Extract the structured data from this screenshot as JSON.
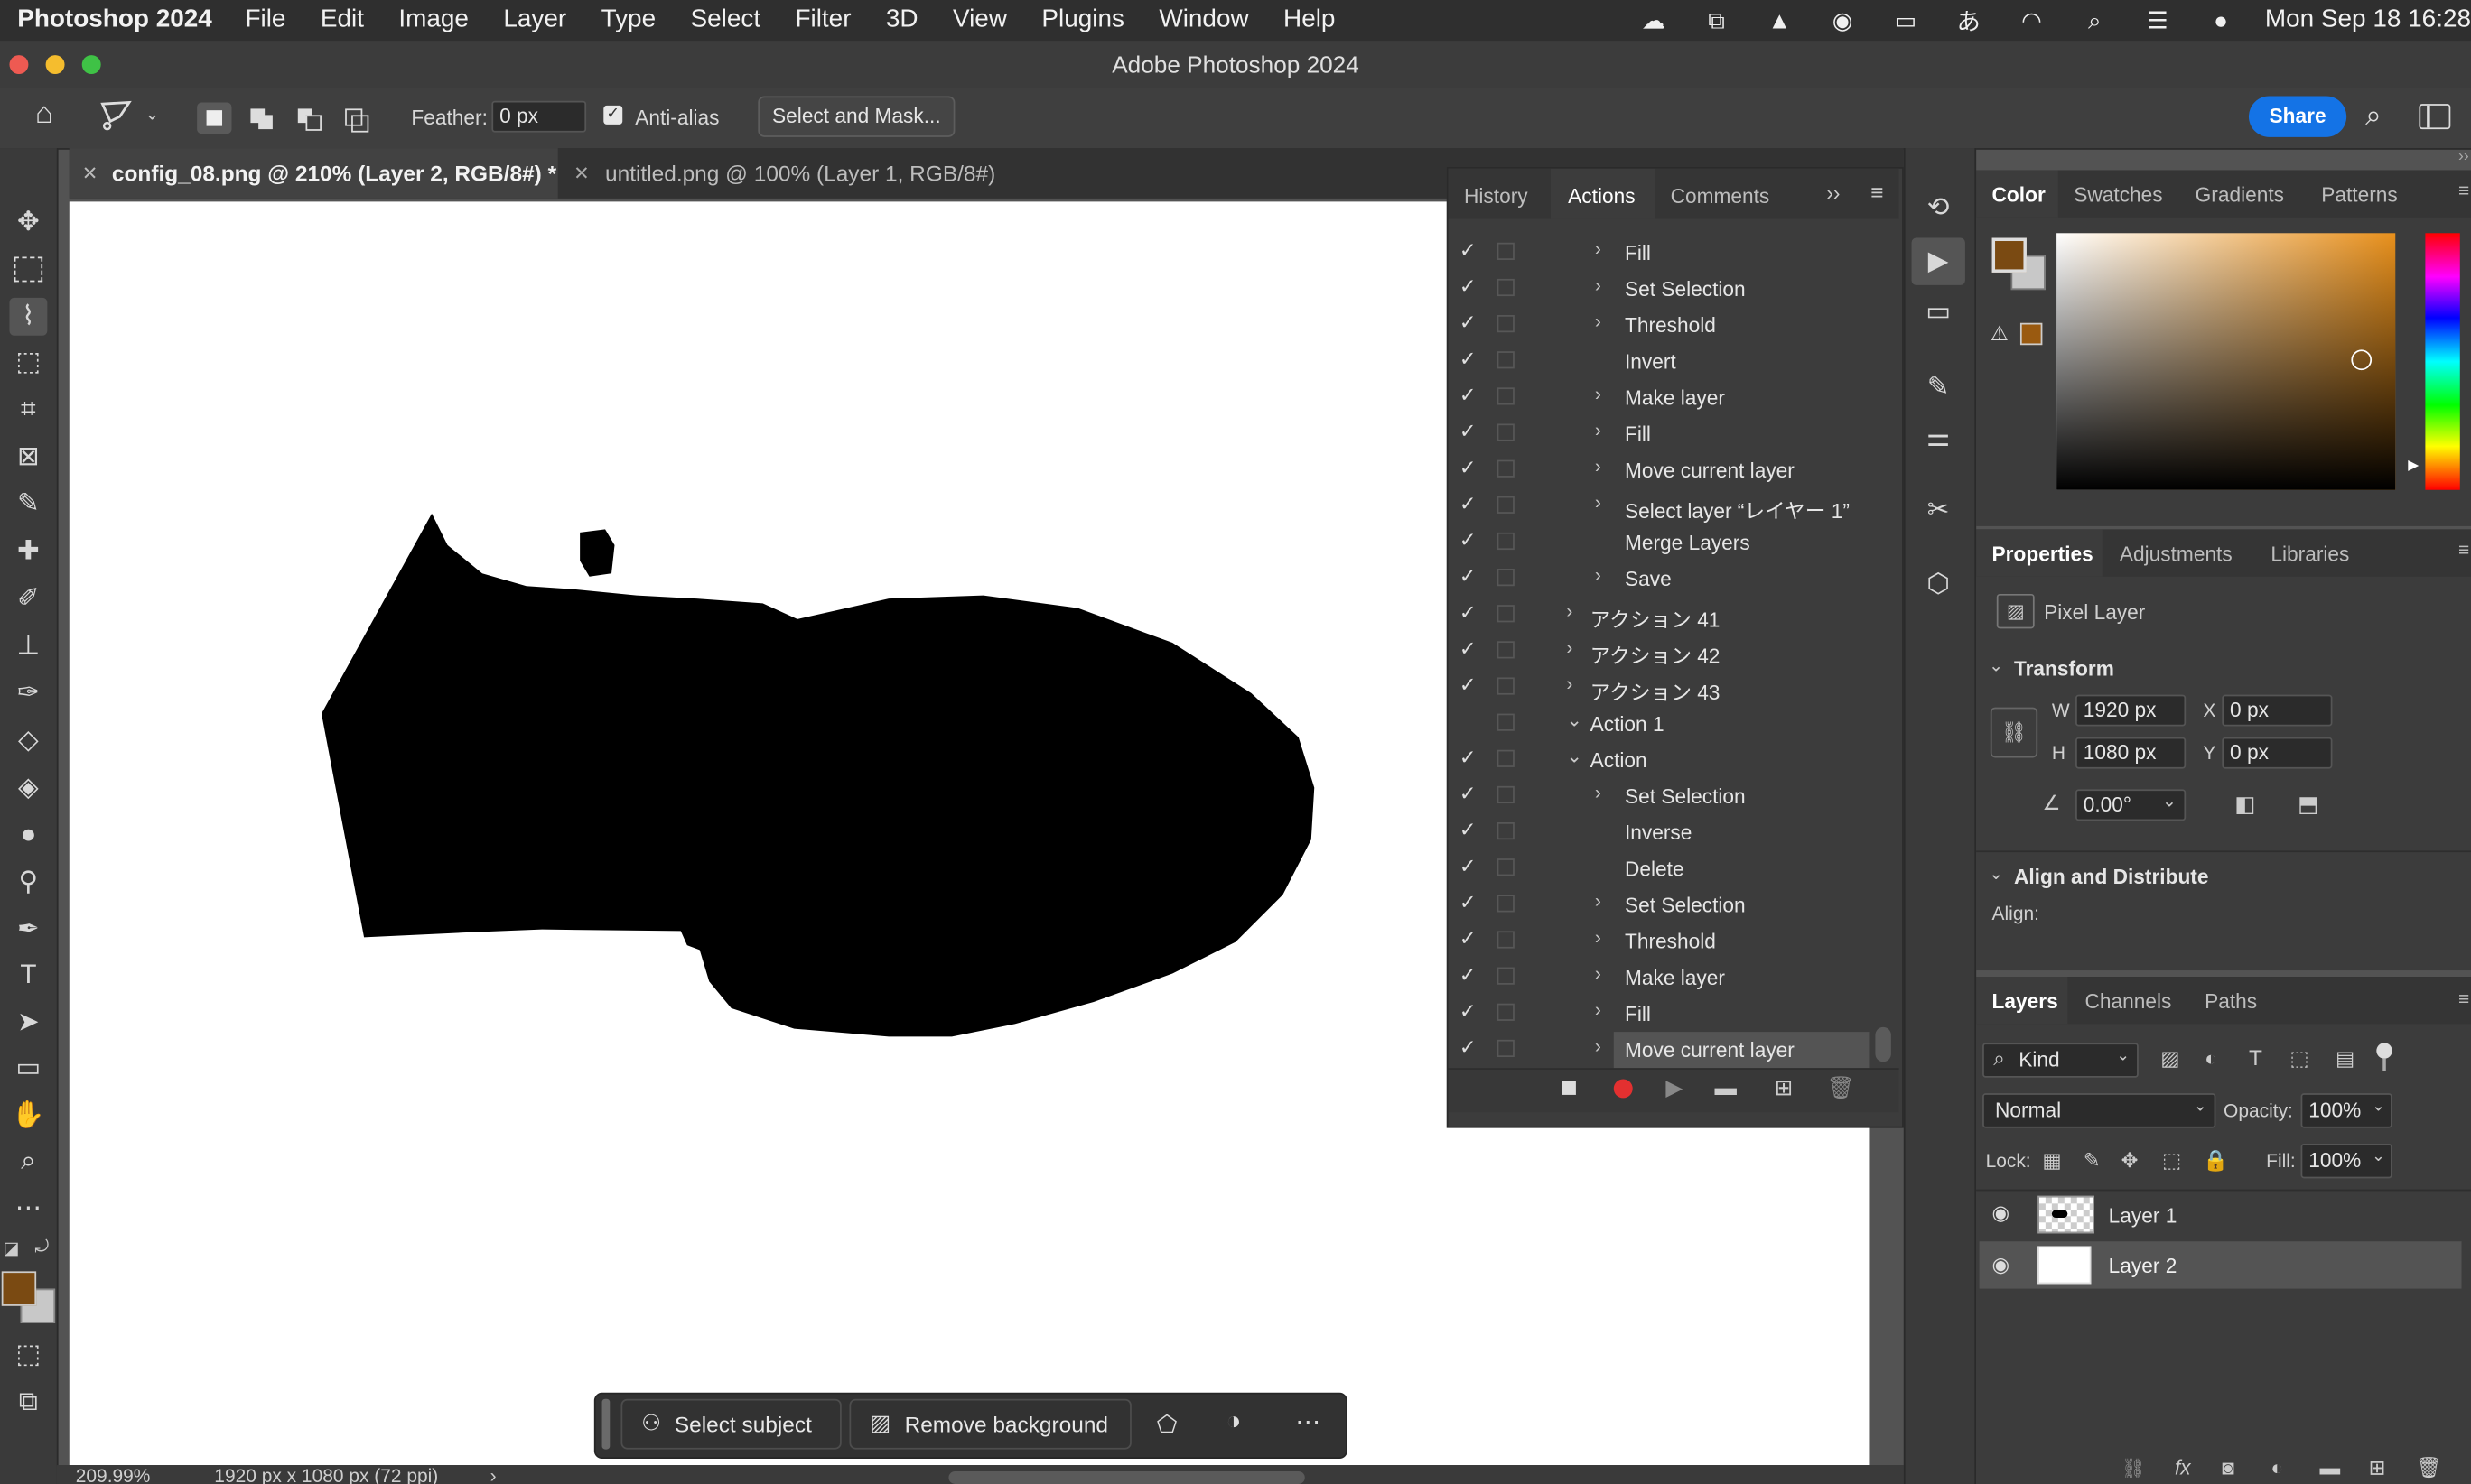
{
  "menubar": {
    "app_name": "Photoshop 2024",
    "items": [
      "File",
      "Edit",
      "Image",
      "Layer",
      "Type",
      "Select",
      "Filter",
      "3D",
      "View",
      "Plugins",
      "Window",
      "Help"
    ],
    "clock": "Mon Sep 18  16:28",
    "status_icons": [
      "creative-cloud-icon",
      "screen-share-icon",
      "acrobat-icon",
      "user-icon",
      "battery-icon",
      "input-method-icon",
      "wifi-icon",
      "spotlight-icon",
      "control-center-icon",
      "siri-icon"
    ],
    "input_method_glyph": "あ"
  },
  "window": {
    "title": "Adobe Photoshop 2024"
  },
  "options": {
    "feather_label": "Feather:",
    "feather_value": "0 px",
    "antialias_label": "Anti-alias",
    "antialias_checked": true,
    "select_mask_label": "Select and Mask...",
    "share_label": "Share"
  },
  "tabs": [
    {
      "label": "config_08.png @ 210% (Layer 2, RGB/8#) *",
      "active": true
    },
    {
      "label": "untitled.png @ 100% (Layer 1, RGB/8#)",
      "active": false
    }
  ],
  "status": {
    "zoom": "209.99%",
    "doc_info": "1920 px x 1080 px (72 ppi)"
  },
  "context_bar": {
    "select_subject": "Select subject",
    "remove_background": "Remove background"
  },
  "actions_panel": {
    "tabs": [
      "History",
      "Actions",
      "Comments"
    ],
    "active_tab": "Actions",
    "rows": [
      {
        "label": "Fill",
        "checked": true,
        "indent": 2,
        "expand": "collapsed"
      },
      {
        "label": "Set Selection",
        "checked": true,
        "indent": 2,
        "expand": "collapsed"
      },
      {
        "label": "Threshold",
        "checked": true,
        "indent": 2,
        "expand": "collapsed"
      },
      {
        "label": "Invert",
        "checked": true,
        "indent": 2,
        "expand": "none"
      },
      {
        "label": "Make layer",
        "checked": true,
        "indent": 2,
        "expand": "collapsed"
      },
      {
        "label": "Fill",
        "checked": true,
        "indent": 2,
        "expand": "collapsed"
      },
      {
        "label": "Move current layer",
        "checked": true,
        "indent": 2,
        "expand": "collapsed"
      },
      {
        "label": "Select layer “レイヤー 1”",
        "checked": true,
        "indent": 2,
        "expand": "collapsed"
      },
      {
        "label": "Merge Layers",
        "checked": true,
        "indent": 2,
        "expand": "none"
      },
      {
        "label": "Save",
        "checked": true,
        "indent": 2,
        "expand": "collapsed"
      },
      {
        "label": "アクション 41",
        "checked": true,
        "indent": 1,
        "expand": "collapsed"
      },
      {
        "label": "アクション 42",
        "checked": true,
        "indent": 1,
        "expand": "collapsed"
      },
      {
        "label": "アクション 43",
        "checked": true,
        "indent": 1,
        "expand": "collapsed"
      },
      {
        "label": "Action 1",
        "checked": false,
        "indent": 1,
        "expand": "expanded"
      },
      {
        "label": "Action",
        "checked": true,
        "indent": 1,
        "expand": "expanded"
      },
      {
        "label": "Set Selection",
        "checked": true,
        "indent": 2,
        "expand": "collapsed"
      },
      {
        "label": "Inverse",
        "checked": true,
        "indent": 2,
        "expand": "none"
      },
      {
        "label": "Delete",
        "checked": true,
        "indent": 2,
        "expand": "none"
      },
      {
        "label": "Set Selection",
        "checked": true,
        "indent": 2,
        "expand": "collapsed"
      },
      {
        "label": "Threshold",
        "checked": true,
        "indent": 2,
        "expand": "collapsed"
      },
      {
        "label": "Make layer",
        "checked": true,
        "indent": 2,
        "expand": "collapsed"
      },
      {
        "label": "Fill",
        "checked": true,
        "indent": 2,
        "expand": "collapsed"
      },
      {
        "label": "Move current layer",
        "checked": true,
        "indent": 2,
        "expand": "collapsed",
        "selected": true
      }
    ]
  },
  "color_panel": {
    "tabs": [
      "Color",
      "Swatches",
      "Gradients",
      "Patterns"
    ],
    "foreground": "#7a4a12",
    "background": "#c8c8c8",
    "hue_base": "#e8901c"
  },
  "properties_panel": {
    "tabs": [
      "Properties",
      "Adjustments",
      "Libraries"
    ],
    "layer_type": "Pixel Layer",
    "transform_label": "Transform",
    "w_label": "W",
    "w_value": "1920 px",
    "h_label": "H",
    "h_value": "1080 px",
    "x_label": "X",
    "x_value": "0 px",
    "y_label": "Y",
    "y_value": "0 px",
    "angle_value": "0.00°",
    "align_label": "Align and Distribute",
    "align_sub": "Align:"
  },
  "layers_panel": {
    "tabs": [
      "Layers",
      "Channels",
      "Paths"
    ],
    "filter_kind": "Kind",
    "blend_mode": "Normal",
    "opacity_label": "Opacity:",
    "opacity_value": "100%",
    "lock_label": "Lock:",
    "fill_label": "Fill:",
    "fill_value": "100%",
    "layers": [
      {
        "name": "Layer 1",
        "visible": true,
        "selected": false
      },
      {
        "name": "Layer 2",
        "visible": true,
        "selected": true
      }
    ]
  }
}
